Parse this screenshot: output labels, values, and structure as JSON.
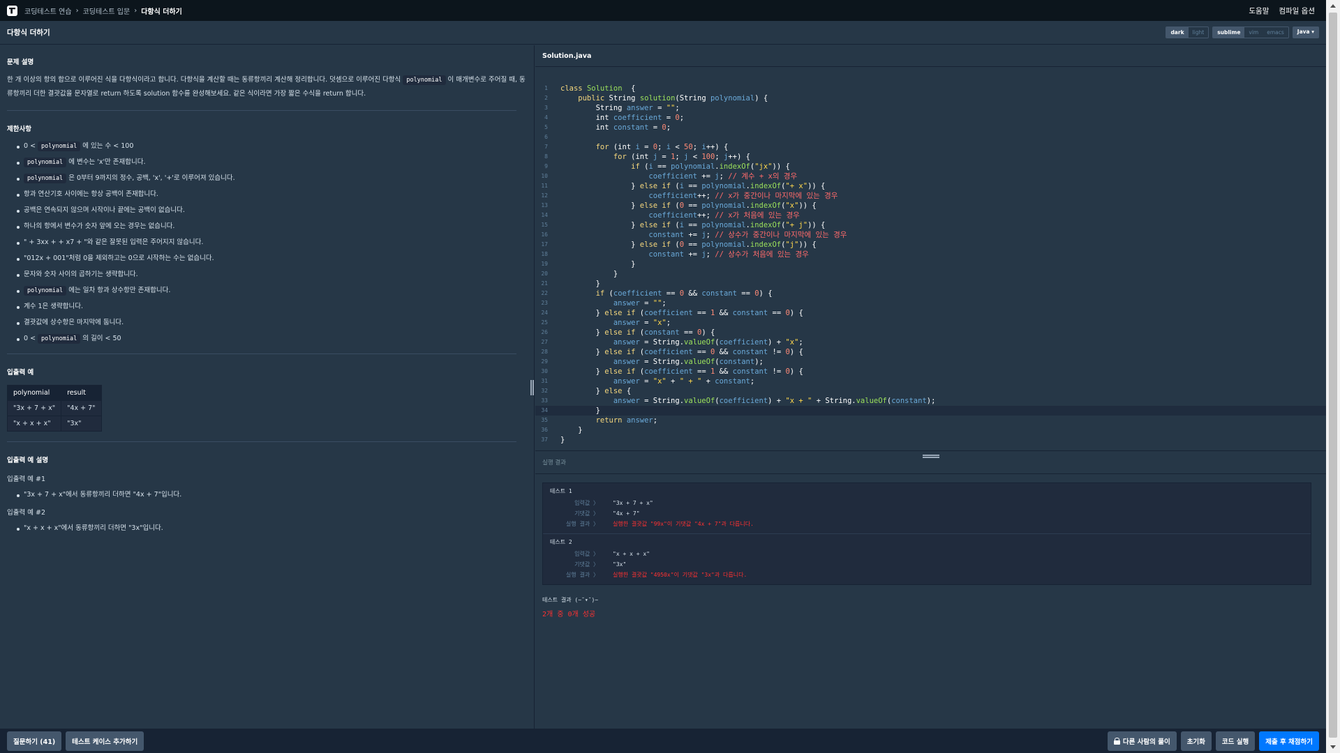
{
  "nav": {
    "breadcrumbs": [
      "코딩테스트 연습",
      "코딩테스트 입문",
      "다항식 더하기"
    ],
    "help": "도움말",
    "compile_options": "컴파일 옵션"
  },
  "header": {
    "title": "다항식 더하기",
    "theme_toggle": [
      "dark",
      "light"
    ],
    "keymap_toggle": [
      "sublime",
      "vim",
      "emacs"
    ],
    "language": "Java"
  },
  "problem": {
    "desc_title": "문제 설명",
    "desc_1": "한 개 이상의 항의 합으로 이루어진 식을 다항식이라고 합니다. 다항식을 계산할 때는 동류항끼리 계산해 정리합니다. 덧셈으로 이루어진 다항식 ",
    "desc_code": "polynomial",
    "desc_2": " 이 매개변수로 주어질 때, 동류항끼리 더한 결괏값을 문자열로 return 하도록 solution 함수를 완성해보세요. 같은 식이라면 가장 짧은 수식을 return 합니다.",
    "constraints_title": "제한사항",
    "constraints": [
      {
        "pre": "0 < ",
        "code": "polynomial",
        "post": " 에 있는 수 < 100"
      },
      {
        "pre": "",
        "code": "polynomial",
        "post": " 에 변수는 'x'만 존재합니다."
      },
      {
        "pre": "",
        "code": "polynomial",
        "post": " 은 0부터 9까지의 정수, 공백, 'x', '+'로 이루어져 있습니다."
      },
      {
        "pre": "항과 연산기호 사이에는 항상 공백이 존재합니다.",
        "code": "",
        "post": ""
      },
      {
        "pre": "공백은 연속되지 않으며 시작이나 끝에는 공백이 없습니다.",
        "code": "",
        "post": ""
      },
      {
        "pre": "하나의 항에서 변수가 숫자 앞에 오는 경우는 없습니다.",
        "code": "",
        "post": ""
      },
      {
        "pre": "\" + 3xx + + x7 + \"와 같은 잘못된 입력은 주어지지 않습니다.",
        "code": "",
        "post": ""
      },
      {
        "pre": "\"012x + 001\"처럼 0을 제외하고는 0으로 시작하는 수는 없습니다.",
        "code": "",
        "post": ""
      },
      {
        "pre": "문자와 숫자 사이의 곱하기는 생략합니다.",
        "code": "",
        "post": ""
      },
      {
        "pre": "",
        "code": "polynomial",
        "post": " 에는 일차 항과 상수항만 존재합니다."
      },
      {
        "pre": "계수 1은 생략합니다.",
        "code": "",
        "post": ""
      },
      {
        "pre": "결괏값에 상수항은 마지막에 둡니다.",
        "code": "",
        "post": ""
      },
      {
        "pre": "0 < ",
        "code": "polynomial",
        "post": " 의 길이 < 50"
      }
    ],
    "io_title": "입출력 예",
    "io_headers": [
      "polynomial",
      "result"
    ],
    "io_rows": [
      [
        "\"3x + 7 + x\"",
        "\"4x + 7\""
      ],
      [
        "\"x + x + x\"",
        "\"3x\""
      ]
    ],
    "io_explain_title": "입출력 예 설명",
    "examples": [
      {
        "title": "입출력 예 #1",
        "text": "\"3x + 7 + x\"에서 동류항끼리 더하면 \"4x + 7\"입니다."
      },
      {
        "title": "입출력 예 #2",
        "text": "\"x + x + x\"에서 동류항끼리 더하면 \"3x\"입니다."
      }
    ]
  },
  "editor": {
    "filename": "Solution.java",
    "code_lines": [
      [
        [
          "kw",
          "class "
        ],
        [
          "fn",
          "Solution"
        ],
        [
          "",
          "  {"
        ]
      ],
      [
        [
          "kw",
          "    public "
        ],
        [
          "",
          "String "
        ],
        [
          "fn",
          "solution"
        ],
        [
          "",
          "(String "
        ],
        [
          "vr",
          "polynomial"
        ],
        [
          "",
          ") {"
        ]
      ],
      [
        [
          "",
          "        String "
        ],
        [
          "vr",
          "answer"
        ],
        [
          "",
          " = "
        ],
        [
          "st",
          "\"\""
        ],
        [
          "",
          ";"
        ]
      ],
      [
        [
          "",
          "        int "
        ],
        [
          "vr",
          "coefficient"
        ],
        [
          "",
          " = "
        ],
        [
          "nm",
          "0"
        ],
        [
          "",
          ";"
        ]
      ],
      [
        [
          "",
          "        int "
        ],
        [
          "vr",
          "constant"
        ],
        [
          "",
          " = "
        ],
        [
          "nm",
          "0"
        ],
        [
          "",
          ";"
        ]
      ],
      [
        [
          "",
          ""
        ]
      ],
      [
        [
          "kw",
          "        for "
        ],
        [
          "",
          "(int "
        ],
        [
          "vr",
          "i"
        ],
        [
          "",
          " = "
        ],
        [
          "nm",
          "0"
        ],
        [
          "",
          "; "
        ],
        [
          "vr",
          "i"
        ],
        [
          "",
          " < "
        ],
        [
          "nm",
          "50"
        ],
        [
          "",
          "; "
        ],
        [
          "vr",
          "i"
        ],
        [
          "",
          "++) {"
        ]
      ],
      [
        [
          "kw",
          "            for "
        ],
        [
          "",
          "(int "
        ],
        [
          "vr",
          "j"
        ],
        [
          "",
          " = "
        ],
        [
          "nm",
          "1"
        ],
        [
          "",
          "; "
        ],
        [
          "vr",
          "j"
        ],
        [
          "",
          " < "
        ],
        [
          "nm",
          "100"
        ],
        [
          "",
          "; "
        ],
        [
          "vr",
          "j"
        ],
        [
          "",
          "++) {"
        ]
      ],
      [
        [
          "kw",
          "                if "
        ],
        [
          "",
          "("
        ],
        [
          "vr",
          "i"
        ],
        [
          "",
          " == "
        ],
        [
          "vr",
          "polynomial"
        ],
        [
          "",
          "."
        ],
        [
          "fn",
          "indexOf"
        ],
        [
          "",
          "("
        ],
        [
          "st",
          "\"jx\""
        ],
        [
          "",
          ")) {"
        ]
      ],
      [
        [
          "vr",
          "                    coefficient"
        ],
        [
          "",
          " += "
        ],
        [
          "vr",
          "j"
        ],
        [
          "",
          "; "
        ],
        [
          "cm",
          "// 계수 + x의 경우"
        ]
      ],
      [
        [
          "",
          "                } "
        ],
        [
          "kw",
          "else if "
        ],
        [
          "",
          "("
        ],
        [
          "vr",
          "i"
        ],
        [
          "",
          " == "
        ],
        [
          "vr",
          "polynomial"
        ],
        [
          "",
          "."
        ],
        [
          "fn",
          "indexOf"
        ],
        [
          "",
          "("
        ],
        [
          "st",
          "\"+ x\""
        ],
        [
          "",
          ")) {"
        ]
      ],
      [
        [
          "vr",
          "                    coefficient"
        ],
        [
          "",
          "++; "
        ],
        [
          "cm",
          "// x가 중간이나 마지막에 있는 경우"
        ]
      ],
      [
        [
          "",
          "                } "
        ],
        [
          "kw",
          "else if "
        ],
        [
          "",
          "("
        ],
        [
          "nm",
          "0"
        ],
        [
          "",
          " == "
        ],
        [
          "vr",
          "polynomial"
        ],
        [
          "",
          "."
        ],
        [
          "fn",
          "indexOf"
        ],
        [
          "",
          "("
        ],
        [
          "st",
          "\"x\""
        ],
        [
          "",
          ")) {"
        ]
      ],
      [
        [
          "vr",
          "                    coefficient"
        ],
        [
          "",
          "++; "
        ],
        [
          "cm",
          "// x가 처음에 있는 경우"
        ]
      ],
      [
        [
          "",
          "                } "
        ],
        [
          "kw",
          "else if "
        ],
        [
          "",
          "("
        ],
        [
          "vr",
          "i"
        ],
        [
          "",
          " == "
        ],
        [
          "vr",
          "polynomial"
        ],
        [
          "",
          "."
        ],
        [
          "fn",
          "indexOf"
        ],
        [
          "",
          "("
        ],
        [
          "st",
          "\"+ j\""
        ],
        [
          "",
          ")) {"
        ]
      ],
      [
        [
          "vr",
          "                    constant"
        ],
        [
          "",
          " += "
        ],
        [
          "vr",
          "j"
        ],
        [
          "",
          "; "
        ],
        [
          "cm",
          "// 상수가 중간이나 마지막에 있는 경우"
        ]
      ],
      [
        [
          "",
          "                } "
        ],
        [
          "kw",
          "else if "
        ],
        [
          "",
          "("
        ],
        [
          "nm",
          "0"
        ],
        [
          "",
          " == "
        ],
        [
          "vr",
          "polynomial"
        ],
        [
          "",
          "."
        ],
        [
          "fn",
          "indexOf"
        ],
        [
          "",
          "("
        ],
        [
          "st",
          "\"j\""
        ],
        [
          "",
          ")) {"
        ]
      ],
      [
        [
          "vr",
          "                    constant"
        ],
        [
          "",
          " += "
        ],
        [
          "vr",
          "j"
        ],
        [
          "",
          "; "
        ],
        [
          "cm",
          "// 상수가 처음에 있는 경우"
        ]
      ],
      [
        [
          "",
          "                }"
        ]
      ],
      [
        [
          "",
          "            }"
        ]
      ],
      [
        [
          "",
          "        }"
        ]
      ],
      [
        [
          "kw",
          "        if "
        ],
        [
          "",
          "("
        ],
        [
          "vr",
          "coefficient"
        ],
        [
          "",
          " == "
        ],
        [
          "nm",
          "0"
        ],
        [
          "",
          " && "
        ],
        [
          "vr",
          "constant"
        ],
        [
          "",
          " == "
        ],
        [
          "nm",
          "0"
        ],
        [
          "",
          ") {"
        ]
      ],
      [
        [
          "vr",
          "            answer"
        ],
        [
          "",
          " = "
        ],
        [
          "st",
          "\"\""
        ],
        [
          "",
          ";"
        ]
      ],
      [
        [
          "",
          "        } "
        ],
        [
          "kw",
          "else if "
        ],
        [
          "",
          "("
        ],
        [
          "vr",
          "coefficient"
        ],
        [
          "",
          " == "
        ],
        [
          "nm",
          "1"
        ],
        [
          "",
          " && "
        ],
        [
          "vr",
          "constant"
        ],
        [
          "",
          " == "
        ],
        [
          "nm",
          "0"
        ],
        [
          "",
          ") {"
        ]
      ],
      [
        [
          "vr",
          "            answer"
        ],
        [
          "",
          " = "
        ],
        [
          "st",
          "\"x\""
        ],
        [
          "",
          ";"
        ]
      ],
      [
        [
          "",
          "        } "
        ],
        [
          "kw",
          "else if "
        ],
        [
          "",
          "("
        ],
        [
          "vr",
          "constant"
        ],
        [
          "",
          " == "
        ],
        [
          "nm",
          "0"
        ],
        [
          "",
          ") {"
        ]
      ],
      [
        [
          "vr",
          "            answer"
        ],
        [
          "",
          " = String."
        ],
        [
          "fn",
          "valueOf"
        ],
        [
          "",
          "("
        ],
        [
          "vr",
          "coefficient"
        ],
        [
          "",
          ") + "
        ],
        [
          "st",
          "\"x\""
        ],
        [
          "",
          ";"
        ]
      ],
      [
        [
          "",
          "        } "
        ],
        [
          "kw",
          "else if "
        ],
        [
          "",
          "("
        ],
        [
          "vr",
          "coefficient"
        ],
        [
          "",
          " == "
        ],
        [
          "nm",
          "0"
        ],
        [
          "",
          " && "
        ],
        [
          "vr",
          "constant"
        ],
        [
          "",
          " != "
        ],
        [
          "nm",
          "0"
        ],
        [
          "",
          ") {"
        ]
      ],
      [
        [
          "vr",
          "            answer"
        ],
        [
          "",
          " = String."
        ],
        [
          "fn",
          "valueOf"
        ],
        [
          "",
          "("
        ],
        [
          "vr",
          "constant"
        ],
        [
          "",
          ");"
        ]
      ],
      [
        [
          "",
          "        } "
        ],
        [
          "kw",
          "else if "
        ],
        [
          "",
          "("
        ],
        [
          "vr",
          "coefficient"
        ],
        [
          "",
          " == "
        ],
        [
          "nm",
          "1"
        ],
        [
          "",
          " && "
        ],
        [
          "vr",
          "constant"
        ],
        [
          "",
          " != "
        ],
        [
          "nm",
          "0"
        ],
        [
          "",
          ") {"
        ]
      ],
      [
        [
          "vr",
          "            answer"
        ],
        [
          "",
          " = "
        ],
        [
          "st",
          "\"x\""
        ],
        [
          "",
          " + "
        ],
        [
          "st",
          "\" + \""
        ],
        [
          "",
          " + "
        ],
        [
          "vr",
          "constant"
        ],
        [
          "",
          ";"
        ]
      ],
      [
        [
          "",
          "        } "
        ],
        [
          "kw",
          "else "
        ],
        [
          "",
          "{"
        ]
      ],
      [
        [
          "vr",
          "            answer"
        ],
        [
          "",
          " = String."
        ],
        [
          "fn",
          "valueOf"
        ],
        [
          "",
          "("
        ],
        [
          "vr",
          "coefficient"
        ],
        [
          "",
          ") + "
        ],
        [
          "st",
          "\"x + \""
        ],
        [
          "",
          " + String."
        ],
        [
          "fn",
          "valueOf"
        ],
        [
          "",
          "("
        ],
        [
          "vr",
          "constant"
        ],
        [
          "",
          ");"
        ]
      ],
      [
        [
          "",
          "        }"
        ]
      ],
      [
        [
          "kw",
          "        return "
        ],
        [
          "vr",
          "answer"
        ],
        [
          "",
          ";"
        ]
      ],
      [
        [
          "",
          "    }"
        ]
      ],
      [
        [
          "",
          "}"
        ]
      ]
    ],
    "active_line": 34
  },
  "result": {
    "title": "실행 결과",
    "labels": {
      "input": "입력값 〉",
      "expected": "기댓값 〉",
      "outcome": "실행 결과 〉"
    },
    "tests": [
      {
        "name": "테스트 1",
        "input": "\"3x + 7 + x\"",
        "expected": "\"4x + 7\"",
        "outcome": "실행한 결괏값 \"99x\"이 기댓값 \"4x + 7\"과 다릅니다."
      },
      {
        "name": "테스트 2",
        "input": "\"x + x + x\"",
        "expected": "\"3x\"",
        "outcome": "실행한 결괏값 \"4950x\"이 기댓값 \"3x\"과 다릅니다."
      }
    ],
    "summary_title": "테스트 결과 (~˘▾˘)~",
    "summary": "2개 중 0개 성공"
  },
  "footer": {
    "ask": "질문하기 (41)",
    "add_testcase": "테스트 케이스 추가하기",
    "others": "다른 사람의 풀이",
    "reset": "초기화",
    "run": "코드 실행",
    "submit": "제출 후 채점하기"
  }
}
